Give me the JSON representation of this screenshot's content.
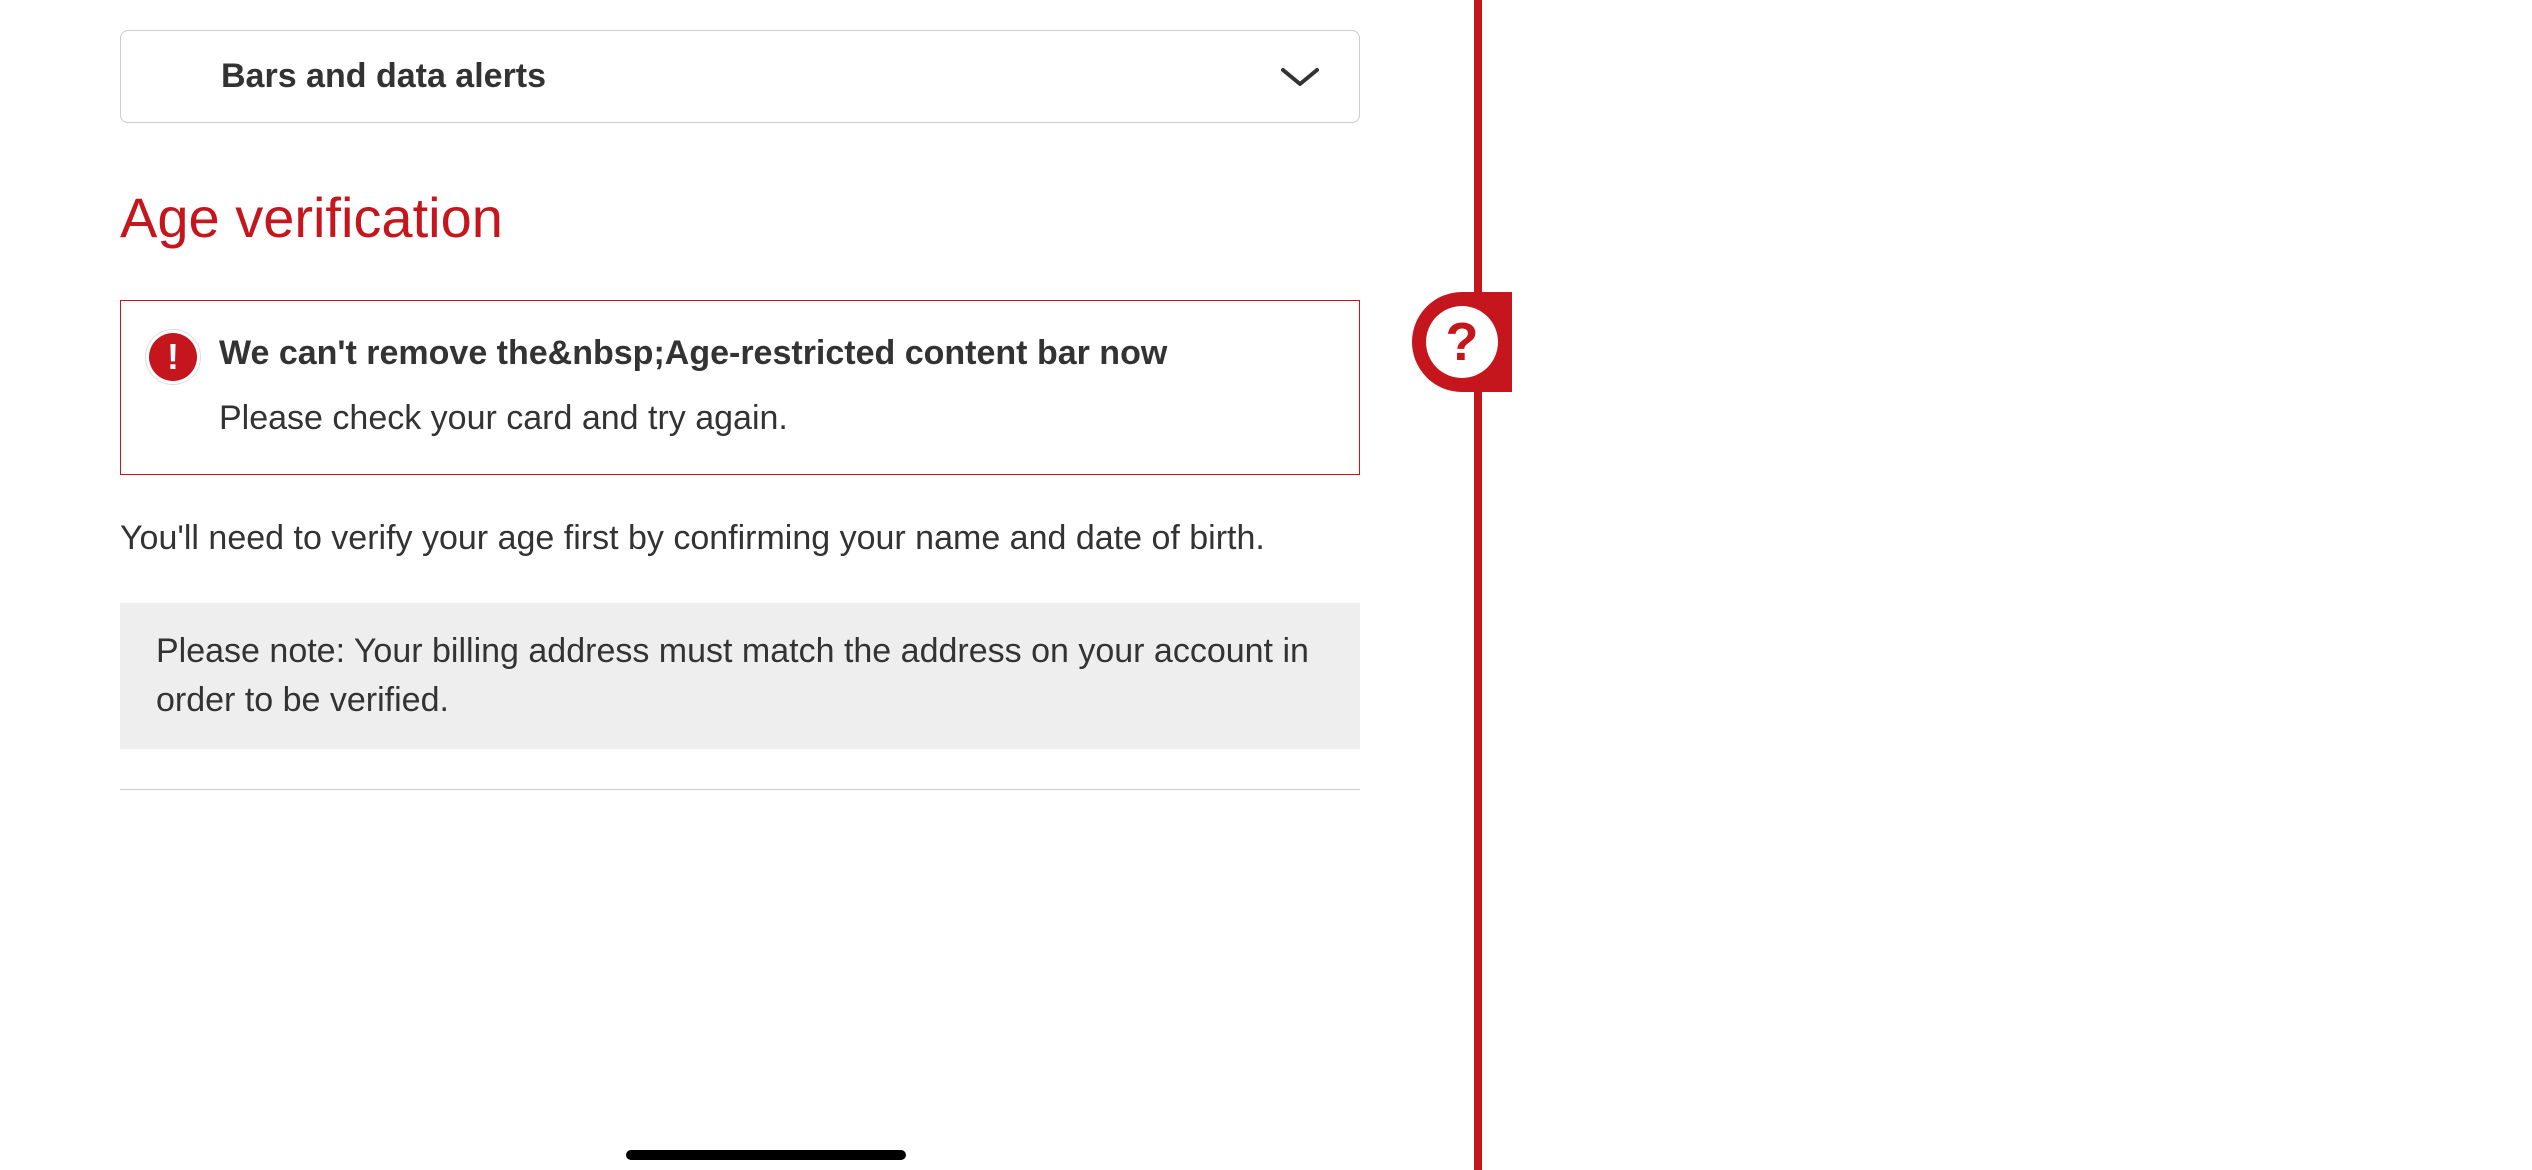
{
  "accordion": {
    "title": "Bars and data alerts"
  },
  "section": {
    "heading": "Age verification"
  },
  "error": {
    "title": "We can't remove the&nbsp;Age-restricted content bar now",
    "message": "Please check your card and try again."
  },
  "instruction": "You'll need to verify your age first by confirming your name and date of birth.",
  "note": "Please note: Your billing address must match the address on your account in order to be verified.",
  "help": {
    "symbol": "?"
  },
  "errorIcon": {
    "symbol": "!"
  }
}
